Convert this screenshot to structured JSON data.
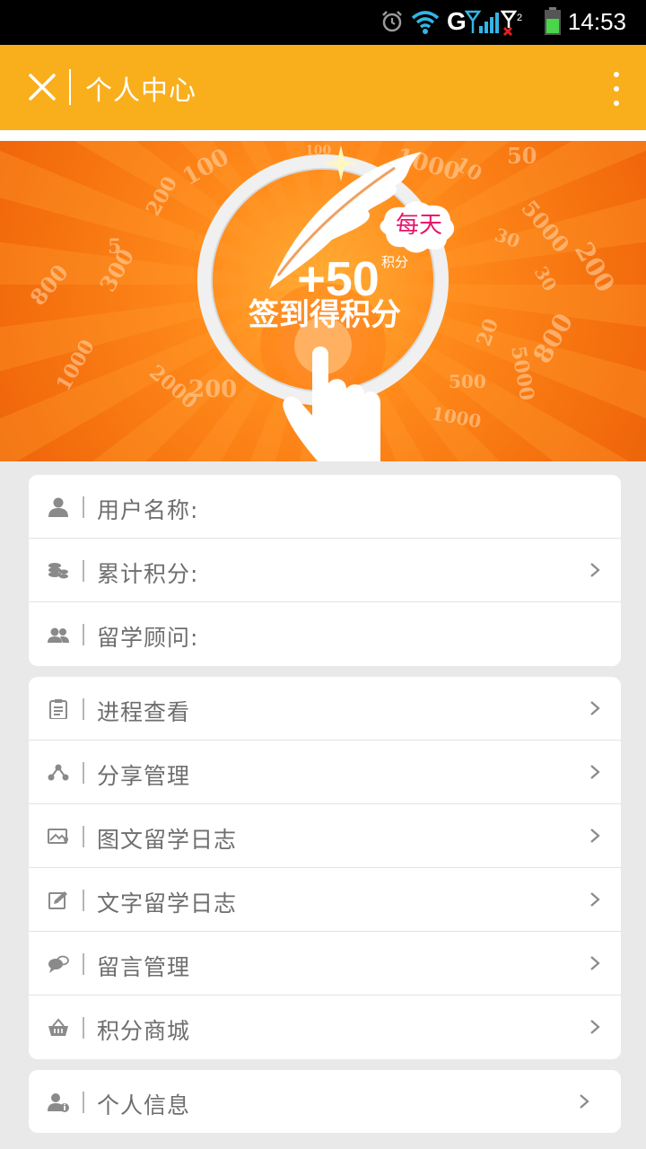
{
  "status_bar": {
    "time": "14:53",
    "network": "G",
    "icons": [
      "alarm-icon",
      "wifi-icon",
      "signal-icon",
      "sim2-no-signal-icon",
      "battery-icon"
    ]
  },
  "header": {
    "title": "个人中心",
    "close_icon": "close-icon",
    "menu_icon": "more-vertical-icon"
  },
  "banner": {
    "badge": "每天",
    "points": "+50",
    "points_unit": "积分",
    "caption": "签到得积分",
    "background_numbers": [
      "100",
      "1000",
      "50",
      "5000",
      "100",
      "5",
      "200",
      "1000",
      "800",
      "300",
      "30",
      "20",
      "500",
      "5000",
      "800",
      "200",
      "2000",
      "1000",
      "10",
      "200",
      "30"
    ]
  },
  "account_card": {
    "rows": [
      {
        "icon": "user-icon",
        "label": "用户名称:",
        "has_arrow": false
      },
      {
        "icon": "coins-icon",
        "label": "累计积分:",
        "has_arrow": true
      },
      {
        "icon": "advisor-icon",
        "label": "留学顾问:",
        "has_arrow": false
      }
    ]
  },
  "menu_card": {
    "rows": [
      {
        "icon": "clipboard-icon",
        "label": "进程查看"
      },
      {
        "icon": "share-icon",
        "label": "分享管理"
      },
      {
        "icon": "photo-diary-icon",
        "label": "图文留学日志"
      },
      {
        "icon": "edit-diary-icon",
        "label": "文字留学日志"
      },
      {
        "icon": "message-icon",
        "label": "留言管理"
      },
      {
        "icon": "basket-icon",
        "label": "积分商城"
      }
    ]
  },
  "profile_card": {
    "rows": [
      {
        "icon": "user-info-icon",
        "label": "个人信息"
      }
    ]
  },
  "colors": {
    "header": "#f9ae1c",
    "banner": "#f26a0c",
    "badge_text": "#e8156c",
    "icon_gray": "#8a8a8a",
    "label_gray": "#6e6e6e"
  }
}
